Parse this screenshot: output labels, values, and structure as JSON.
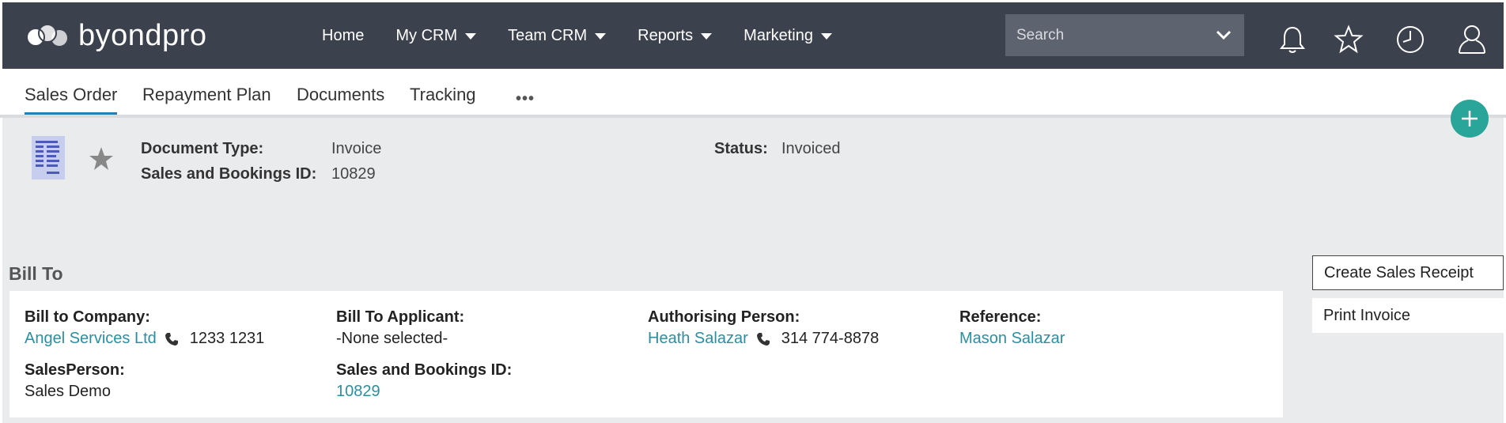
{
  "header": {
    "logo_text": "byondpro",
    "nav": [
      {
        "label": "Home",
        "has_caret": false
      },
      {
        "label": "My CRM",
        "has_caret": true
      },
      {
        "label": "Team CRM",
        "has_caret": true
      },
      {
        "label": "Reports",
        "has_caret": true
      },
      {
        "label": "Marketing",
        "has_caret": true
      }
    ],
    "search_placeholder": "Search",
    "icons": [
      "bell-icon",
      "star-icon",
      "clock-icon",
      "user-icon"
    ]
  },
  "tabs": [
    {
      "label": "Sales Order",
      "active": true
    },
    {
      "label": "Repayment Plan",
      "active": false
    },
    {
      "label": "Documents",
      "active": false
    },
    {
      "label": "Tracking",
      "active": false
    }
  ],
  "tab_more": "•••",
  "record": {
    "document_type_label": "Document Type:",
    "document_type": "Invoice",
    "sales_bookings_id_label": "Sales and Bookings ID:",
    "sales_bookings_id": "10829",
    "status_label": "Status:",
    "status": "Invoiced"
  },
  "bill_to": {
    "title": "Bill To",
    "company_label": "Bill to Company:",
    "company": "Angel Services Ltd",
    "company_phone": "1233 1231",
    "applicant_label": "Bill To Applicant:",
    "applicant": "-None selected-",
    "authorising_label": "Authorising Person:",
    "authorising": "Heath Salazar",
    "authorising_phone": "314 774-8878",
    "reference_label": "Reference:",
    "reference": "Mason Salazar",
    "salesperson_label": "SalesPerson:",
    "salesperson": "Sales Demo",
    "bookings_id_label": "Sales and Bookings ID:",
    "bookings_id": "10829"
  },
  "actions": {
    "create_receipt": "Create Sales Receipt",
    "print_invoice": "Print Invoice"
  },
  "colors": {
    "topbar": "#3c414e",
    "accent_link": "#2a8fa0",
    "fab": "#2aa59a",
    "active_tab_underline": "#2a7db3"
  }
}
